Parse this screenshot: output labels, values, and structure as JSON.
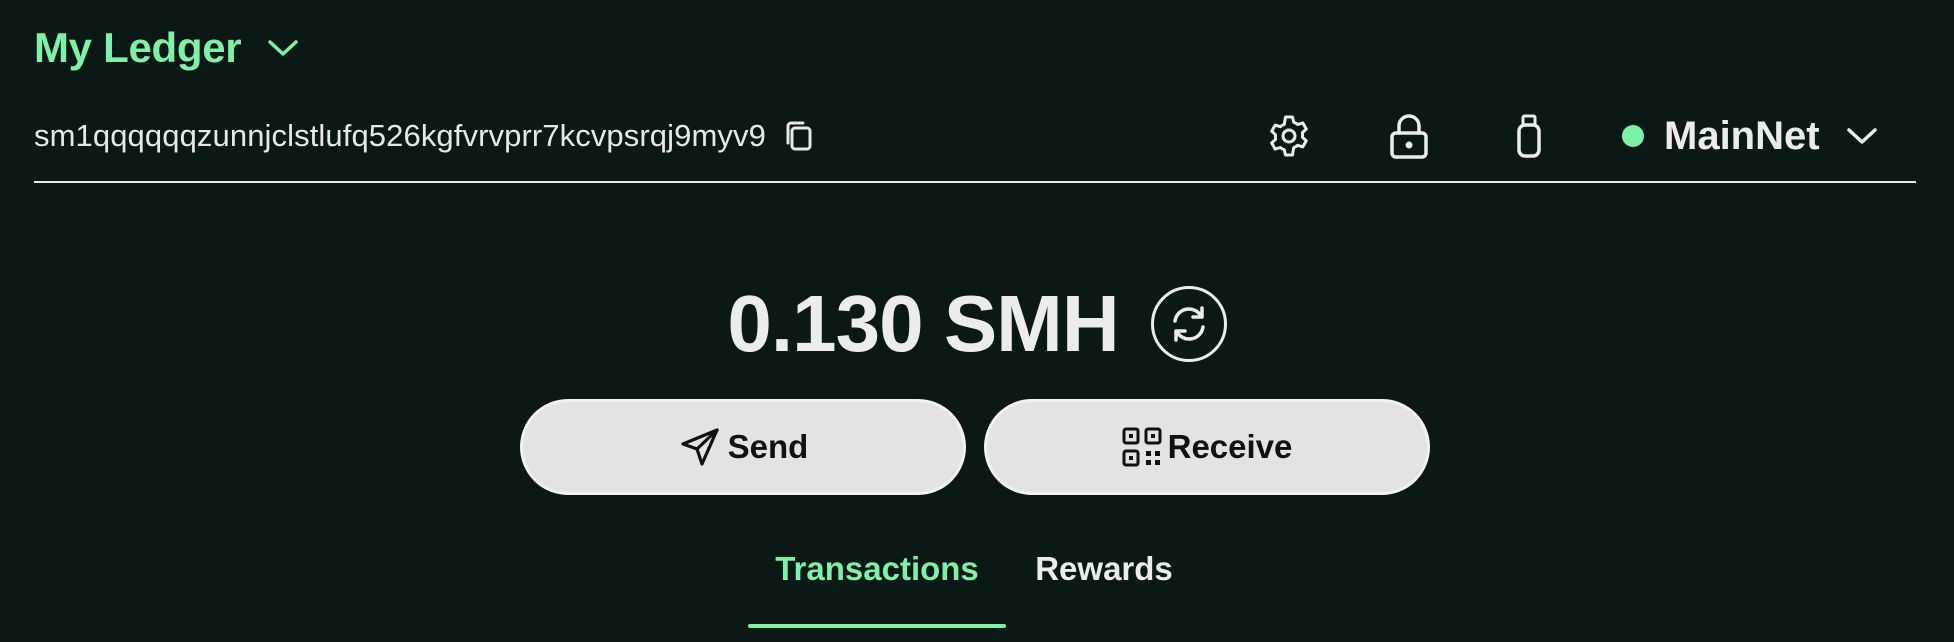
{
  "wallet": {
    "name": "My Ledger"
  },
  "account": {
    "address": "sm1qqqqqqzunnjclstlufq526kgfvrvprr7kcvpsrqj9myv9"
  },
  "network": {
    "name": "MainNet",
    "status_color": "#7ff0a8"
  },
  "balance": {
    "display": "0.130 SMH"
  },
  "actions": {
    "send_label": "Send",
    "receive_label": "Receive"
  },
  "tabs": [
    {
      "label": "Transactions",
      "active": true
    },
    {
      "label": "Rewards",
      "active": false
    }
  ],
  "icons": {
    "wallet_dropdown": "chevron-down-icon",
    "copy": "copy-icon",
    "settings": "gear-icon",
    "lock": "lock-icon",
    "device": "usb-device-icon",
    "network_dropdown": "chevron-down-icon",
    "refresh": "refresh-icon",
    "send": "paper-plane-icon",
    "receive": "qr-code-icon"
  },
  "colors": {
    "background": "#0b1916",
    "accent": "#7ff0a8",
    "text": "#ececec",
    "button_bg": "#e3e3e3"
  }
}
